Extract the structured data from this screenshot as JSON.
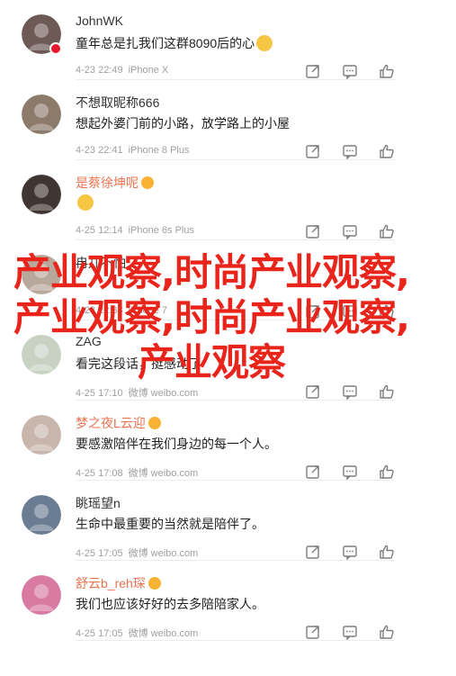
{
  "comments": [
    {
      "username": "JohnWK",
      "orange": false,
      "content": "童年总是扎我们这群8090后的心",
      "time": "4-23 22:49",
      "source": "iPhone X",
      "avatar_color": "#6d5a57"
    },
    {
      "username": "不想取昵称666",
      "orange": false,
      "content": "想起外婆门前的小路，放学路上的小屋",
      "time": "4-23 22:41",
      "source": "iPhone 8 Plus",
      "avatar_color": "#8c7a6b"
    },
    {
      "username": "是蔡徐坤呢",
      "orange": true,
      "content": "",
      "time": "4-25 12:14",
      "source": "iPhone 6s Plus",
      "avatar_color": "#3f3532"
    },
    {
      "username": "冉儿不怕",
      "orange": false,
      "content": "",
      "time": "4-23 22:38",
      "source": "iPhone 7",
      "avatar_color": "#b8a79b"
    },
    {
      "username": "ZAG",
      "orange": false,
      "content": "看完这段话，挺感动了",
      "time": "4-25 17:10",
      "source": "微博 weibo.com",
      "avatar_color": "#c7d2c3"
    },
    {
      "username": "梦之夜L云迎",
      "orange": true,
      "content": "要感激陪伴在我们身边的每一个人。",
      "time": "4-25 17:08",
      "source": "微博 weibo.com",
      "avatar_color": "#c8b6ac"
    },
    {
      "username": "眺瑶望n",
      "orange": false,
      "content": "生命中最重要的当然就是陪伴了。",
      "time": "4-25 17:05",
      "source": "微博 weibo.com",
      "avatar_color": "#6b7d93"
    },
    {
      "username": "舒云b_reh琛",
      "orange": true,
      "content": "我们也应该好好的去多陪陪家人。",
      "time": "4-25 17:05",
      "source": "微博 weibo.com",
      "avatar_color": "#d87aa2"
    }
  ],
  "overlay_text": "产业观察,时尚产业观察,产业观察,时尚产业观察,产业观察",
  "icons": [
    "share-icon",
    "comment-icon",
    "like-icon"
  ],
  "colors": {
    "overlay": "#e8241b",
    "username_orange": "#eb7350",
    "meta": "#a0a0a0"
  }
}
